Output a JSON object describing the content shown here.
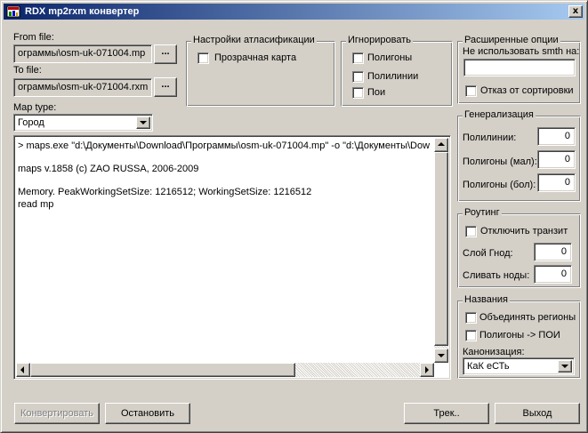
{
  "window": {
    "title": "RDX mp2rxm конвертер",
    "close_label": "x"
  },
  "files": {
    "from_label": "From file:",
    "from_value": "ограммы\\osm-uk-071004.mp",
    "to_label": "To file:",
    "to_value": "ограммы\\osm-uk-071004.rxm",
    "browse_label": "..."
  },
  "map_type": {
    "label": "Map type:",
    "value": "Город"
  },
  "atlas": {
    "title": "Настройки атласификации",
    "transparent_label": "Прозрачная карта"
  },
  "ignore": {
    "title": "Игнорировать",
    "polygons_label": "Полигоны",
    "polylines_label": "Полилинии",
    "poi_label": "Пои"
  },
  "advanced": {
    "title": "Расширенные опции",
    "smth_label": "Не использовать smth на:",
    "smth_value": "",
    "no_sort_label": "Отказ от сортировки"
  },
  "generalization": {
    "title": "Генерализация",
    "polylines_label": "Полилинии:",
    "polylines_value": "0",
    "polygons_small_label": "Полигоны (мал):",
    "polygons_small_value": "0",
    "polygons_large_label": "Полигоны (бол):",
    "polygons_large_value": "0"
  },
  "routing": {
    "title": "Роутинг",
    "disable_transit_label": "Отключить транзит",
    "layer_label": "Слой Гнод:",
    "layer_value": "0",
    "merge_label": "Сливать ноды:",
    "merge_value": "0"
  },
  "names": {
    "title": "Названия",
    "merge_regions_label": "Объединять регионы",
    "polygons_poi_label": "Полигоны -> ПОИ",
    "canon_label": "Канонизация:",
    "canon_value": "КаК еСТь"
  },
  "log": {
    "lines": [
      "> maps.exe \"d:\\Документы\\Download\\Программы\\osm-uk-071004.mp\" -o \"d:\\Документы\\Dow",
      "maps v.1858 (c) ZAO RUSSA, 2006-2009",
      "Memory. PeakWorkingSetSize: 1216512; WorkingSetSize: 1216512",
      "read mp"
    ]
  },
  "buttons": {
    "convert": "Конвертировать",
    "stop": "Остановить",
    "track": "Трек..",
    "exit": "Выход"
  }
}
